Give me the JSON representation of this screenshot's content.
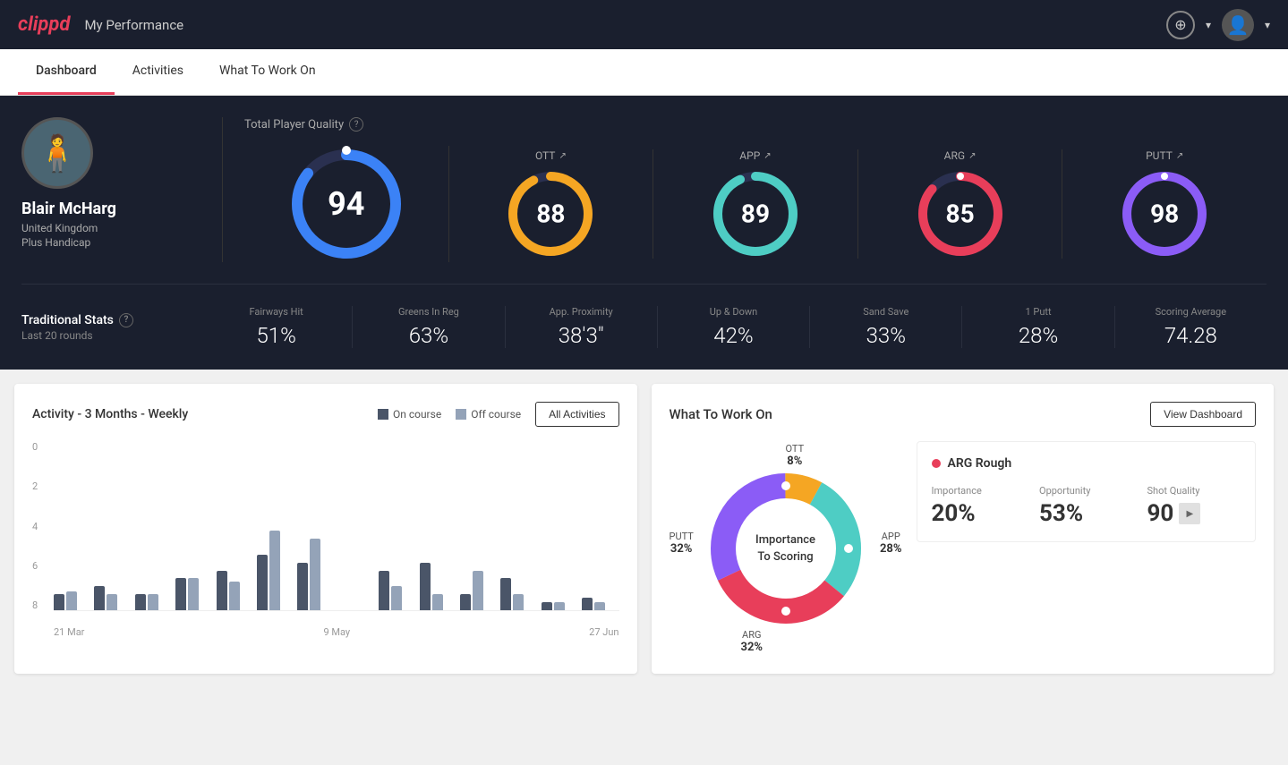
{
  "app": {
    "name": "clippd",
    "header_title": "My Performance"
  },
  "tabs": [
    {
      "id": "dashboard",
      "label": "Dashboard",
      "active": true
    },
    {
      "id": "activities",
      "label": "Activities",
      "active": false
    },
    {
      "id": "what-to-work-on",
      "label": "What To Work On",
      "active": false
    }
  ],
  "profile": {
    "name": "Blair McHarg",
    "country": "United Kingdom",
    "handicap": "Plus Handicap"
  },
  "quality": {
    "label": "Total Player Quality",
    "main_score": 94,
    "scores": [
      {
        "id": "ott",
        "label": "OTT",
        "value": 88,
        "color": "#f5a623",
        "trend": "↗"
      },
      {
        "id": "app",
        "label": "APP",
        "value": 89,
        "color": "#4ecdc4",
        "trend": "↗"
      },
      {
        "id": "arg",
        "label": "ARG",
        "value": 85,
        "color": "#e83e5a",
        "trend": "↗"
      },
      {
        "id": "putt",
        "label": "PUTT",
        "value": 98,
        "color": "#8b5cf6",
        "trend": "↗"
      }
    ]
  },
  "traditional_stats": {
    "label": "Traditional Stats",
    "help": "?",
    "sublabel": "Last 20 rounds",
    "stats": [
      {
        "label": "Fairways Hit",
        "value": "51%"
      },
      {
        "label": "Greens In Reg",
        "value": "63%"
      },
      {
        "label": "App. Proximity",
        "value": "38'3\""
      },
      {
        "label": "Up & Down",
        "value": "42%"
      },
      {
        "label": "Sand Save",
        "value": "33%"
      },
      {
        "label": "1 Putt",
        "value": "28%"
      },
      {
        "label": "Scoring Average",
        "value": "74.28"
      }
    ]
  },
  "activity_chart": {
    "title": "Activity - 3 Months - Weekly",
    "legend": [
      {
        "label": "On course",
        "color": "#4a5568"
      },
      {
        "label": "Off course",
        "color": "#94a3b8"
      }
    ],
    "all_activities_btn": "All Activities",
    "y_labels": [
      "0",
      "2",
      "4",
      "6",
      "8"
    ],
    "x_labels": [
      "21 Mar",
      "9 May",
      "27 Jun"
    ],
    "bars": [
      {
        "on": 1,
        "off": 1.2
      },
      {
        "on": 1.5,
        "off": 1
      },
      {
        "on": 1,
        "off": 1
      },
      {
        "on": 2,
        "off": 2
      },
      {
        "on": 2.5,
        "off": 1.8
      },
      {
        "on": 3.5,
        "off": 5
      },
      {
        "on": 3,
        "off": 4.5
      },
      {
        "on": 0,
        "off": 0
      },
      {
        "on": 2.5,
        "off": 1.5
      },
      {
        "on": 3,
        "off": 1
      },
      {
        "on": 1,
        "off": 2.5
      },
      {
        "on": 2,
        "off": 1
      },
      {
        "on": 0.5,
        "off": 0.5
      },
      {
        "on": 0.8,
        "off": 0.5
      }
    ],
    "max_value": 9
  },
  "what_to_work_on": {
    "title": "What To Work On",
    "view_dashboard_btn": "View Dashboard",
    "donut": {
      "center_text": "Importance\nTo Scoring",
      "segments": [
        {
          "label": "OTT",
          "value": 8,
          "color": "#f5a623",
          "position": {
            "top": "5%",
            "left": "55%"
          }
        },
        {
          "label": "APP",
          "value": 28,
          "color": "#4ecdc4",
          "position": {
            "top": "48%",
            "right": "-2%"
          }
        },
        {
          "label": "ARG",
          "value": 32,
          "color": "#e83e5a",
          "position": {
            "bottom": "2%",
            "left": "40%"
          }
        },
        {
          "label": "PUTT",
          "value": 32,
          "color": "#8b5cf6",
          "position": {
            "top": "45%",
            "left": "-8%"
          }
        }
      ]
    },
    "info_card": {
      "title": "ARG Rough",
      "dot_color": "#e83e5a",
      "stats": [
        {
          "label": "Importance",
          "value": "20%"
        },
        {
          "label": "Opportunity",
          "value": "53%"
        },
        {
          "label": "Shot Quality",
          "value": "90"
        }
      ]
    }
  }
}
